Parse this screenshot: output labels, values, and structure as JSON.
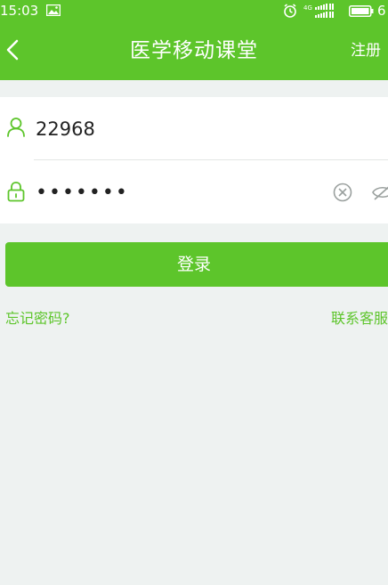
{
  "status_bar": {
    "time": "15:03",
    "network_text": "4G",
    "battery_text": "6"
  },
  "header": {
    "title": "医学移动课堂",
    "register_label": "注册"
  },
  "form": {
    "username_value": "22968",
    "username_placeholder": "",
    "password_value": "•••••••",
    "password_placeholder": ""
  },
  "actions": {
    "login_label": "登录",
    "forgot_password_label": "忘记密码?",
    "contact_service_label": "联系客服"
  },
  "colors": {
    "accent": "#5dc52b",
    "background": "#eef2f1",
    "card": "#ffffff",
    "icon_gray": "#9aa09e"
  },
  "icons": {
    "back": "back-arrow-icon",
    "user": "user-icon",
    "lock": "lock-icon",
    "clear": "clear-icon",
    "eye": "eye-hidden-icon"
  }
}
